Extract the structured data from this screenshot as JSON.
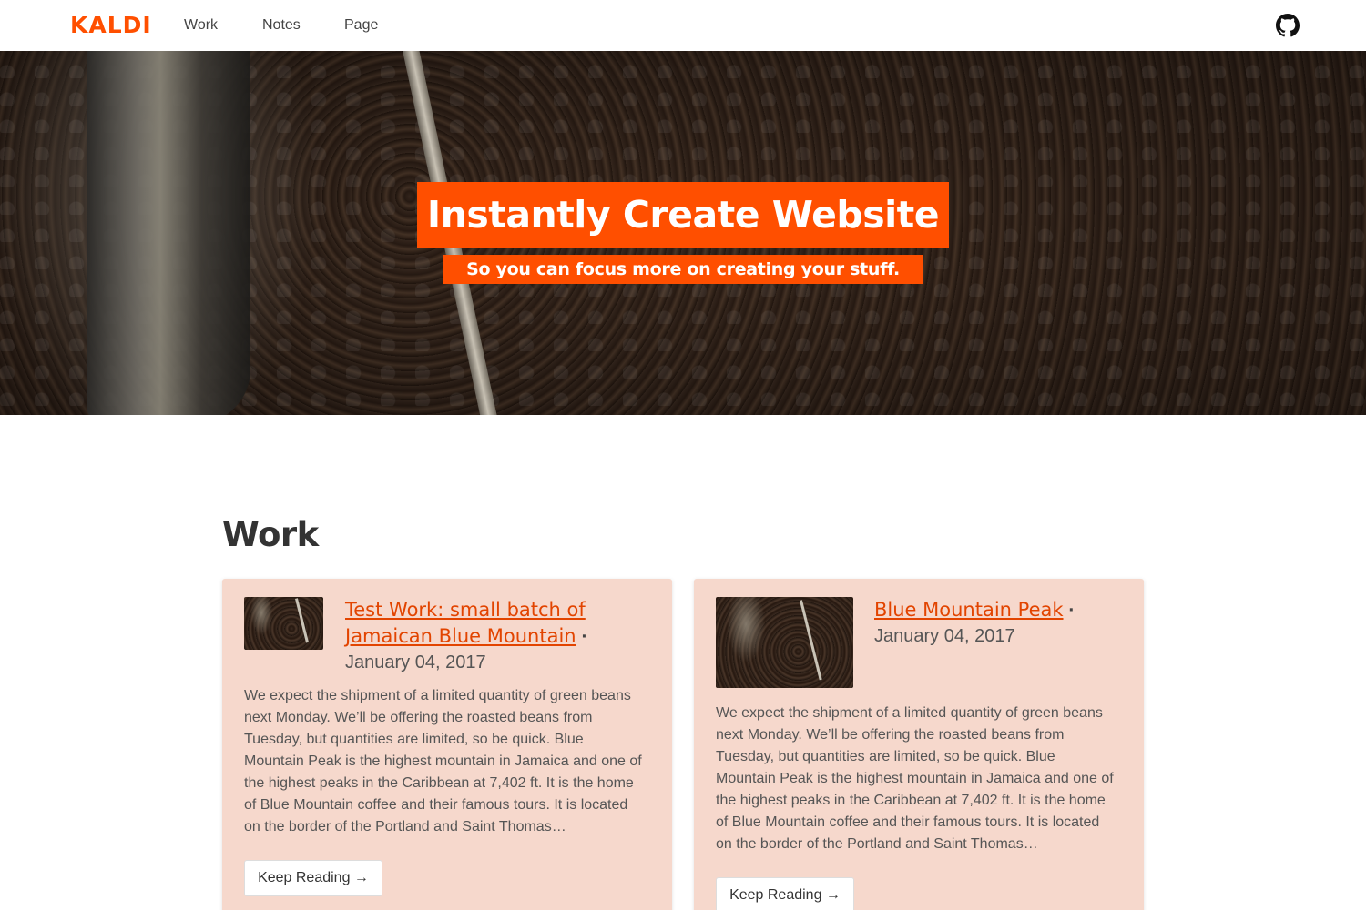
{
  "header": {
    "brand": "KALDI",
    "nav": [
      {
        "label": "Work"
      },
      {
        "label": "Notes"
      },
      {
        "label": "Page"
      }
    ],
    "github_icon": "github-icon"
  },
  "hero": {
    "title": "Instantly Create Website",
    "subtitle": "So you can focus more on creating your stuff."
  },
  "colors": {
    "accent": "#ff4f00",
    "card_bg": "#f6d8cc",
    "link": "#e24400"
  },
  "work": {
    "title": "Work",
    "items": [
      {
        "title": "Test Work: small batch of Jamaican Blue Mountain",
        "separator": "·",
        "date": "January 04, 2017",
        "excerpt": "We expect the shipment of a limited quantity of green beans next Monday. We’ll be offering the roasted beans from Tuesday, but quantities are limited, so be quick. Blue Mountain Peak is the highest mountain in Jamaica and one of the highest peaks in the Caribbean at 7,402 ft. It is the home of Blue Mountain coffee and their famous tours. It is located on the border of the Portland and Saint Thomas…",
        "button": "Keep Reading →"
      },
      {
        "title": "Blue Mountain Peak",
        "separator": "·",
        "date": "January 04, 2017",
        "excerpt": "We expect the shipment of a limited quantity of green beans next Monday. We’ll be offering the roasted beans from Tuesday, but quantities are limited, so be quick. Blue Mountain Peak is the highest mountain in Jamaica and one of the highest peaks in the Caribbean at 7,402 ft. It is the home of Blue Mountain coffee and their famous tours. It is located on the border of the Portland and Saint Thomas…",
        "button": "Keep Reading →"
      }
    ]
  }
}
